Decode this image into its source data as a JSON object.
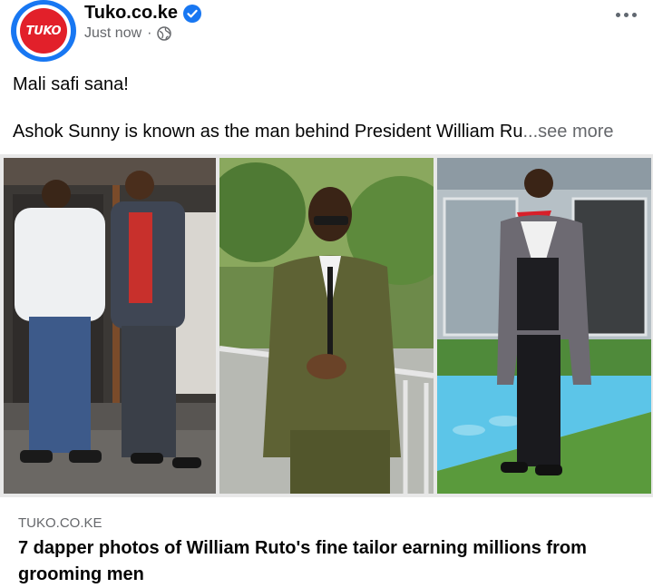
{
  "post": {
    "page_name": "Tuko.co.ke",
    "timestamp": "Just now",
    "separator": "·",
    "avatar_logo_text": "TUKO",
    "verified_icon": "verified-badge-icon",
    "privacy_icon": "globe-icon",
    "options_icon": "more-options-icon",
    "text_line1": "Mali safi sana!",
    "text_line2": "Ashok Sunny is known as the man behind President William Ru",
    "ellipsis": "...",
    "see_more_label": "see more"
  },
  "link_preview": {
    "domain": "TUKO.CO.KE",
    "title": "7 dapper photos of William Ruto's fine tailor earning millions from grooming men"
  },
  "colors": {
    "brand_blue": "#1877f2",
    "tuko_red": "#e2202a",
    "secondary_text": "#65676b"
  }
}
